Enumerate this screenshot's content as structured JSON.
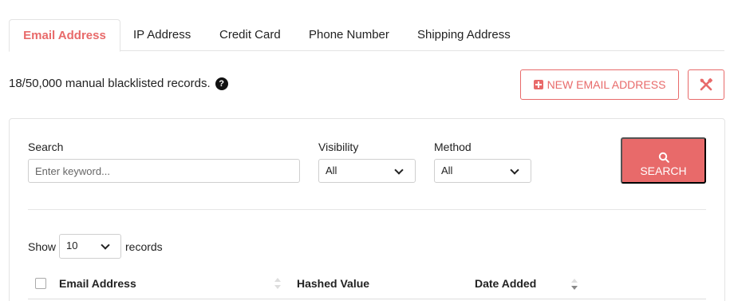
{
  "tabs": [
    {
      "label": "Email Address",
      "active": true
    },
    {
      "label": "IP Address",
      "active": false
    },
    {
      "label": "Credit Card",
      "active": false
    },
    {
      "label": "Phone Number",
      "active": false
    },
    {
      "label": "Shipping Address",
      "active": false
    }
  ],
  "records_info": "18/50,000 manual blacklisted records.",
  "help_icon_glyph": "?",
  "new_button_label": "NEW EMAIL ADDRESS",
  "tools_icon": "tools-icon",
  "filters": {
    "search_label": "Search",
    "search_placeholder": "Enter keyword...",
    "search_value": "",
    "visibility_label": "Visibility",
    "visibility_value": "All",
    "method_label": "Method",
    "method_value": "All",
    "search_button_label": "SEARCH"
  },
  "pagination": {
    "show_label": "Show",
    "page_size": "10",
    "records_label": "records"
  },
  "table": {
    "columns": [
      "Email Address",
      "Hashed Value",
      "Date Added"
    ]
  },
  "colors": {
    "accent": "#e86a6a",
    "border": "#e3e3e3"
  }
}
